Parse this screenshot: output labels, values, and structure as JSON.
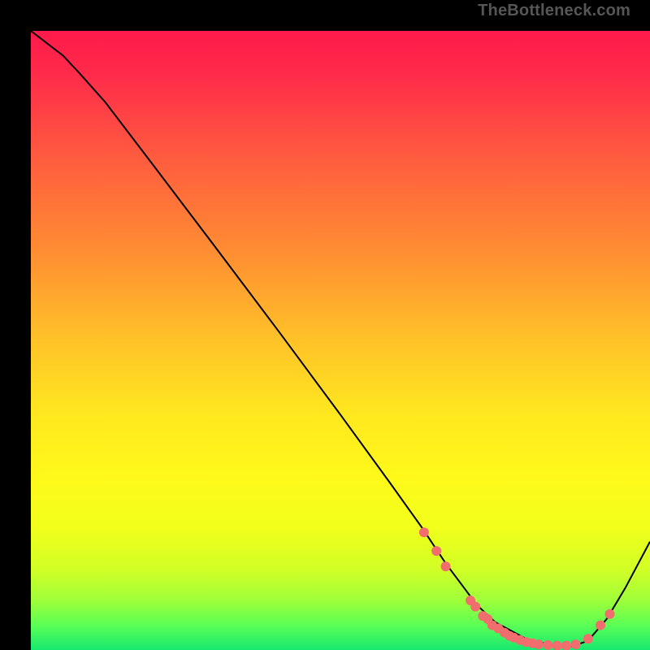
{
  "watermark": "TheBottleneck.com",
  "chart_data": {
    "type": "line",
    "title": "",
    "xlabel": "",
    "ylabel": "",
    "xlim": [
      0,
      100
    ],
    "ylim": [
      0,
      100
    ],
    "grid": false,
    "legend": false,
    "background": {
      "type": "vertical-gradient",
      "stops": [
        {
          "offset": 0.0,
          "color": "#ff1a4b"
        },
        {
          "offset": 0.07,
          "color": "#ff2b4a"
        },
        {
          "offset": 0.2,
          "color": "#ff5a3f"
        },
        {
          "offset": 0.35,
          "color": "#ff8b33"
        },
        {
          "offset": 0.5,
          "color": "#ffc228"
        },
        {
          "offset": 0.62,
          "color": "#ffe81f"
        },
        {
          "offset": 0.72,
          "color": "#fff91a"
        },
        {
          "offset": 0.8,
          "color": "#f2ff1a"
        },
        {
          "offset": 0.87,
          "color": "#d1ff26"
        },
        {
          "offset": 0.92,
          "color": "#9fff3a"
        },
        {
          "offset": 0.96,
          "color": "#5bff55"
        },
        {
          "offset": 1.0,
          "color": "#17e86f"
        }
      ]
    },
    "series": [
      {
        "name": "curve",
        "x": [
          0.0,
          5.2,
          8.0,
          12.0,
          20.0,
          30.0,
          40.0,
          50.0,
          58.0,
          63.0,
          67.0,
          70.0,
          72.0,
          75.0,
          80.0,
          84.0,
          87.5,
          90.0,
          93.0,
          96.0,
          100.0
        ],
        "y": [
          100.0,
          96.0,
          93.0,
          88.5,
          78.0,
          64.8,
          51.5,
          38.0,
          27.0,
          20.0,
          14.0,
          10.0,
          7.3,
          4.5,
          1.8,
          0.8,
          0.6,
          1.5,
          5.0,
          10.0,
          17.5
        ],
        "stroke": "#000000",
        "stroke_width": 2
      }
    ],
    "markers": {
      "color": "#f26d6d",
      "radius": 6,
      "points": [
        {
          "x": 63.5,
          "y": 19.0
        },
        {
          "x": 65.5,
          "y": 16.0
        },
        {
          "x": 67.0,
          "y": 13.5
        },
        {
          "x": 71.0,
          "y": 8.0
        },
        {
          "x": 71.8,
          "y": 7.0
        },
        {
          "x": 73.0,
          "y": 5.5
        },
        {
          "x": 73.8,
          "y": 5.0
        },
        {
          "x": 74.5,
          "y": 4.0
        },
        {
          "x": 75.5,
          "y": 3.5
        },
        {
          "x": 76.5,
          "y": 2.8
        },
        {
          "x": 77.3,
          "y": 2.3
        },
        {
          "x": 78.0,
          "y": 2.0
        },
        {
          "x": 79.0,
          "y": 1.6
        },
        {
          "x": 80.0,
          "y": 1.3
        },
        {
          "x": 81.0,
          "y": 1.1
        },
        {
          "x": 82.0,
          "y": 0.9
        },
        {
          "x": 83.5,
          "y": 0.8
        },
        {
          "x": 85.0,
          "y": 0.7
        },
        {
          "x": 86.5,
          "y": 0.7
        },
        {
          "x": 88.0,
          "y": 0.9
        },
        {
          "x": 90.0,
          "y": 1.8
        },
        {
          "x": 92.0,
          "y": 4.0
        },
        {
          "x": 93.5,
          "y": 5.8
        }
      ]
    }
  }
}
